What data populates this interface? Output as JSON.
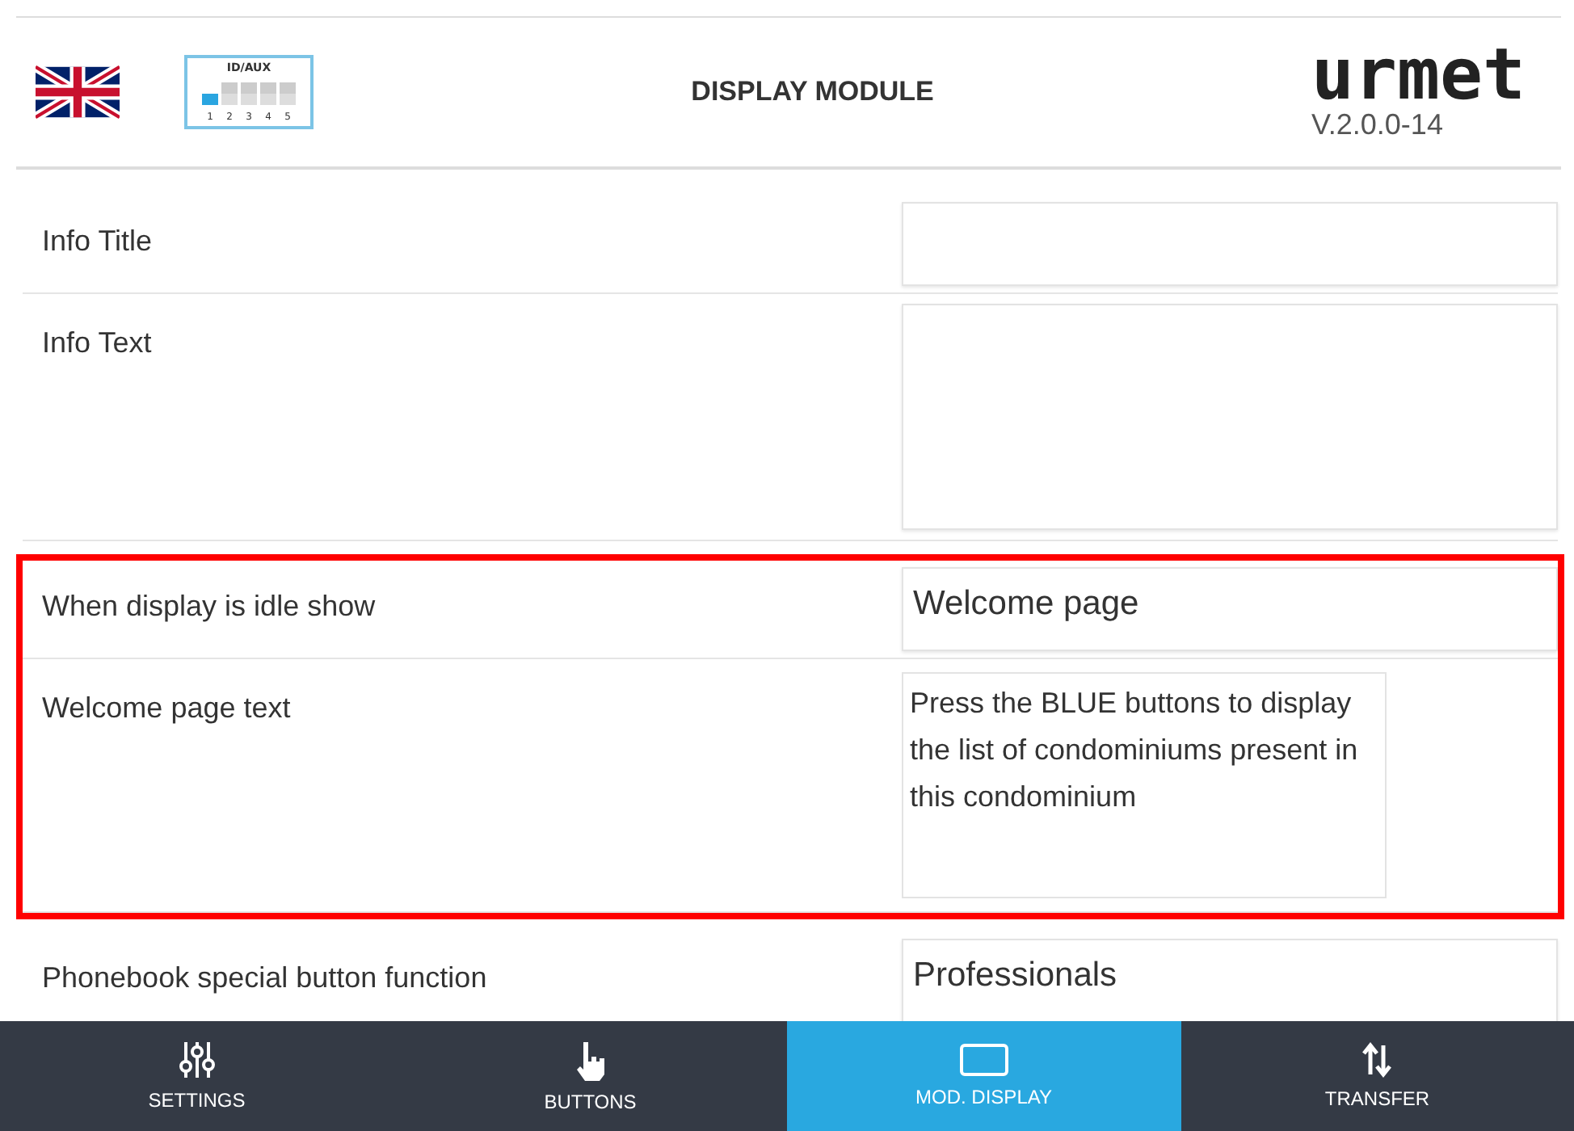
{
  "header": {
    "title": "DISPLAY MODULE",
    "logo": "urmet",
    "version": "V.2.0.0-14",
    "id_aux": {
      "label": "ID/AUX",
      "switches": [
        {
          "number": "1",
          "on": true
        },
        {
          "number": "2",
          "on": false
        },
        {
          "number": "3",
          "on": false
        },
        {
          "number": "4",
          "on": false
        },
        {
          "number": "5",
          "on": false
        }
      ]
    }
  },
  "rows": [
    {
      "kind": "input",
      "label": "Info Title",
      "value": "",
      "highlighted": false
    },
    {
      "kind": "textarea",
      "label": "Info Text",
      "value": "",
      "highlighted": false
    },
    {
      "kind": "select",
      "label": "When display is idle show",
      "value": "Welcome page",
      "highlighted": true
    },
    {
      "kind": "textarea",
      "label": "Welcome page text",
      "value": "Press the BLUE buttons to display the list of condominiums present in this condominium",
      "highlighted": true
    },
    {
      "kind": "select",
      "label": "Phonebook special button function",
      "value": "Professionals",
      "highlighted": false
    }
  ],
  "nav": [
    {
      "kind": "settings",
      "label": "SETTINGS",
      "selected": false
    },
    {
      "kind": "buttons",
      "label": "BUTTONS",
      "selected": false
    },
    {
      "kind": "display",
      "label": "MOD. DISPLAY",
      "selected": true
    },
    {
      "kind": "transfer",
      "label": "TRANSFER",
      "selected": false
    }
  ]
}
